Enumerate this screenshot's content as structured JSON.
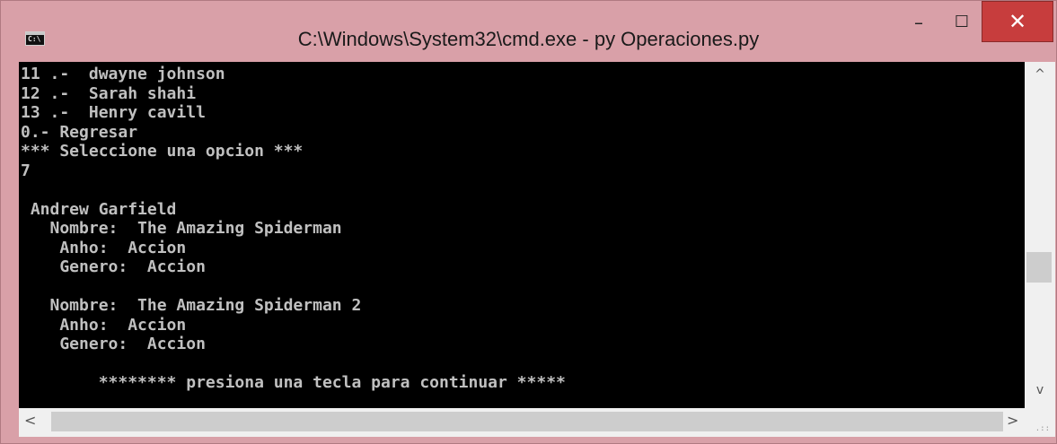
{
  "window": {
    "title": "C:\\Windows\\System32\\cmd.exe - py  Operaciones.py",
    "icon": "cmd-icon",
    "controls": {
      "minimize": "–",
      "maximize": "☐",
      "close": "✕"
    }
  },
  "console": {
    "lines": [
      "11 .-  dwayne johnson",
      "12 .-  Sarah shahi",
      "13 .-  Henry cavill",
      "0.- Regresar",
      "*** Seleccione una opcion ***",
      "7",
      "",
      " Andrew Garfield",
      "   Nombre:  The Amazing Spiderman",
      "    Anho:  Accion",
      "    Genero:  Accion",
      "",
      "   Nombre:  The Amazing Spiderman 2",
      "    Anho:  Accion",
      "    Genero:  Accion",
      "",
      "        ******** presiona una tecla para continuar *****"
    ]
  },
  "scrollbars": {
    "vertical": {
      "up": "^",
      "down": "v",
      "position": 0.62
    },
    "horizontal": {
      "left": "<",
      "right": ">"
    }
  },
  "colors": {
    "titlebar": "#d9a0a8",
    "close_button": "#c73d3d",
    "console_bg": "#000000",
    "console_fg": "#c0c0c0"
  }
}
